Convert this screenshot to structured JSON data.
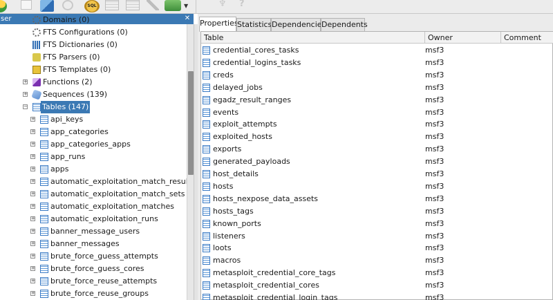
{
  "toolbar": {
    "sql_label": "SQL",
    "items": [
      "refresh-icon",
      "new-object-icon",
      "copy-icon",
      "recycle-icon",
      "sql-query-icon",
      "view-data-icon",
      "filtered-data-icon",
      "maintenance-icon",
      "plugins-icon",
      "pin-icon",
      "help-icon"
    ]
  },
  "browser": {
    "title": "ser",
    "tree": [
      {
        "label": "Domains (0)",
        "icon": "domain-icon",
        "expander": false
      },
      {
        "label": "FTS Configurations (0)",
        "icon": "fts-config-icon",
        "expander": false
      },
      {
        "label": "FTS Dictionaries (0)",
        "icon": "fts-dictionary-icon",
        "expander": false
      },
      {
        "label": "FTS Parsers (0)",
        "icon": "fts-parser-icon",
        "expander": false
      },
      {
        "label": "FTS Templates (0)",
        "icon": "fts-template-icon",
        "expander": false
      },
      {
        "label": "Functions (2)",
        "icon": "function-icon",
        "expander": true
      },
      {
        "label": "Sequences (139)",
        "icon": "sequence-icon",
        "expander": true
      },
      {
        "label": "Tables (147)",
        "icon": "tables-icon",
        "expander": true,
        "expanded": true,
        "selected": true
      }
    ],
    "tables": [
      "api_keys",
      "app_categories",
      "app_categories_apps",
      "app_runs",
      "apps",
      "automatic_exploitation_match_results",
      "automatic_exploitation_match_sets",
      "automatic_exploitation_matches",
      "automatic_exploitation_runs",
      "banner_message_users",
      "banner_messages",
      "brute_force_guess_attempts",
      "brute_force_guess_cores",
      "brute_force_reuse_attempts",
      "brute_force_reuse_groups"
    ]
  },
  "tabs": [
    "Properties",
    "Statistics",
    "Dependencies",
    "Dependents"
  ],
  "active_tab": "Properties",
  "grid": {
    "columns": [
      "Table",
      "Owner",
      "Comment"
    ],
    "rows": [
      {
        "table": "credential_cores_tasks",
        "owner": "msf3"
      },
      {
        "table": "credential_logins_tasks",
        "owner": "msf3"
      },
      {
        "table": "creds",
        "owner": "msf3"
      },
      {
        "table": "delayed_jobs",
        "owner": "msf3"
      },
      {
        "table": "egadz_result_ranges",
        "owner": "msf3"
      },
      {
        "table": "events",
        "owner": "msf3"
      },
      {
        "table": "exploit_attempts",
        "owner": "msf3"
      },
      {
        "table": "exploited_hosts",
        "owner": "msf3"
      },
      {
        "table": "exports",
        "owner": "msf3"
      },
      {
        "table": "generated_payloads",
        "owner": "msf3"
      },
      {
        "table": "host_details",
        "owner": "msf3"
      },
      {
        "table": "hosts",
        "owner": "msf3"
      },
      {
        "table": "hosts_nexpose_data_assets",
        "owner": "msf3"
      },
      {
        "table": "hosts_tags",
        "owner": "msf3"
      },
      {
        "table": "known_ports",
        "owner": "msf3"
      },
      {
        "table": "listeners",
        "owner": "msf3"
      },
      {
        "table": "loots",
        "owner": "msf3"
      },
      {
        "table": "macros",
        "owner": "msf3"
      },
      {
        "table": "metasploit_credential_core_tags",
        "owner": "msf3"
      },
      {
        "table": "metasploit_credential_cores",
        "owner": "msf3"
      },
      {
        "table": "metasploit_credential_login_tags",
        "owner": "msf3"
      }
    ]
  }
}
